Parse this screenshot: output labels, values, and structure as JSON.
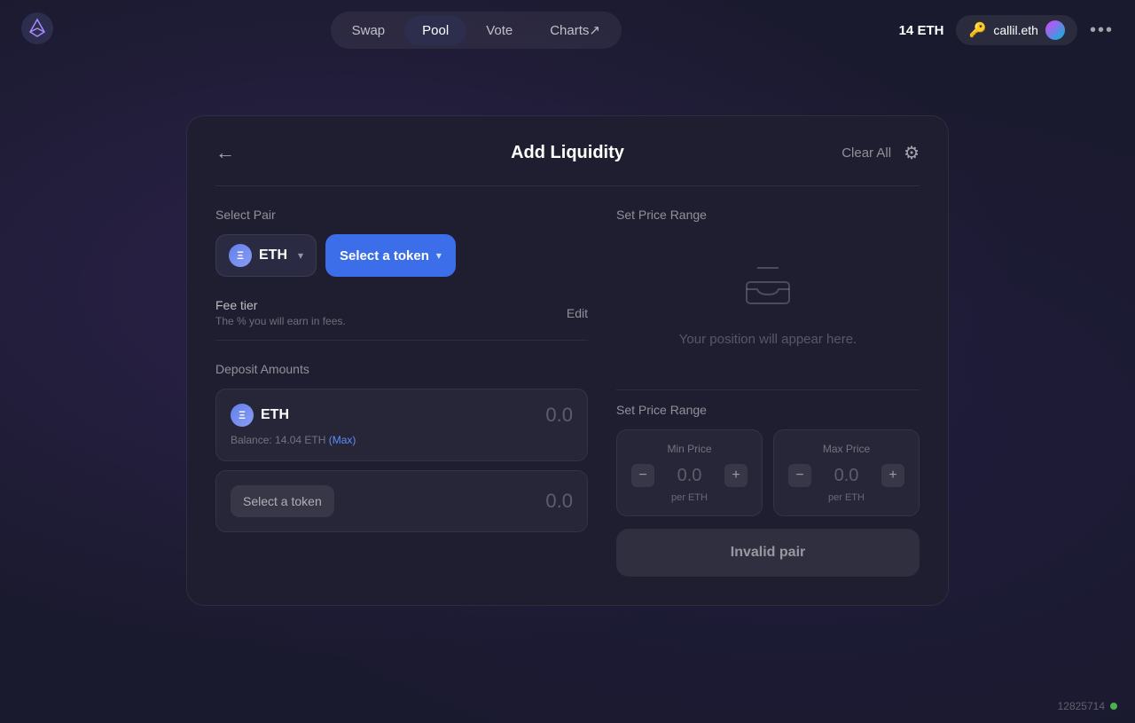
{
  "nav": {
    "tabs": [
      {
        "id": "swap",
        "label": "Swap",
        "active": false
      },
      {
        "id": "pool",
        "label": "Pool",
        "active": true
      },
      {
        "id": "vote",
        "label": "Vote",
        "active": false
      },
      {
        "id": "charts",
        "label": "Charts↗",
        "active": false
      }
    ],
    "balance": "14 ETH",
    "wallet": "callil.eth",
    "more_icon": "•••"
  },
  "card": {
    "title": "Add Liquidity",
    "back_label": "←",
    "clear_all_label": "Clear All",
    "settings_icon": "⚙"
  },
  "select_pair": {
    "label": "Select Pair",
    "token1": {
      "name": "ETH",
      "icon": "Ξ"
    },
    "token2": {
      "placeholder": "Select a token"
    }
  },
  "fee_tier": {
    "title": "Fee tier",
    "description": "The % you will earn in fees.",
    "edit_label": "Edit"
  },
  "deposit": {
    "label": "Deposit Amounts",
    "token1": {
      "name": "ETH",
      "icon": "Ξ",
      "amount": "0.0",
      "balance_label": "Balance: 14.04 ETH",
      "max_label": "(Max)"
    },
    "token2": {
      "select_label": "Select a token",
      "amount": "0.0"
    }
  },
  "set_price_range_top": {
    "label": "Set Price Range"
  },
  "position_placeholder": {
    "text": "Your position will appear here."
  },
  "set_price_range_bottom": {
    "label": "Set Price Range",
    "min": {
      "label": "Min Price",
      "value": "0.0",
      "unit": "per ETH"
    },
    "max": {
      "label": "Max Price",
      "value": "0.0",
      "unit": "per ETH"
    }
  },
  "invalid_pair_btn": "Invalid pair",
  "block_number": "12825714"
}
